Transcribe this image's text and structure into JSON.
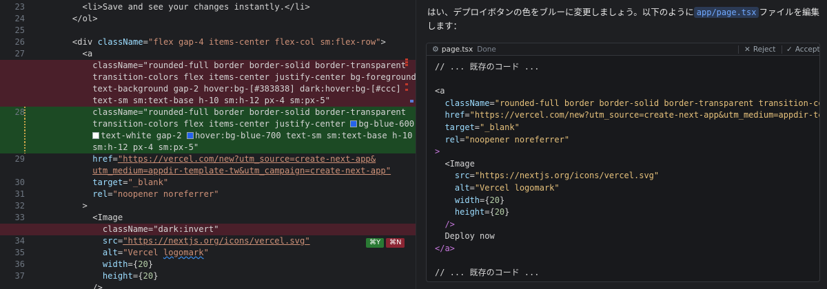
{
  "editor": {
    "lines": [
      {
        "no": "23",
        "indent": "        ",
        "parts": [
          {
            "t": "<li>Save and see your changes instantly.</li>",
            "c": "tag"
          }
        ]
      },
      {
        "no": "24",
        "indent": "      ",
        "parts": [
          {
            "t": "</ol>",
            "c": "tag"
          }
        ]
      },
      {
        "no": "25",
        "indent": "",
        "parts": []
      },
      {
        "no": "26",
        "indent": "      ",
        "parts": [
          {
            "t": "<div ",
            "c": "tag"
          },
          {
            "t": "className",
            "c": "attr"
          },
          {
            "t": "=",
            "c": "punc"
          },
          {
            "t": "\"flex gap-4 items-center flex-col sm:flex-row\"",
            "c": "str"
          },
          {
            "t": ">",
            "c": "tag"
          }
        ]
      },
      {
        "no": "27",
        "indent": "        ",
        "parts": [
          {
            "t": "<a",
            "c": "tag"
          }
        ]
      }
    ],
    "deleted_lines": [
      "className=\"rounded-full border border-solid border-transparent",
      "transition-colors flex items-center justify-center bg-foreground",
      "text-background gap-2 hover:bg-[#383838] dark:hover:bg-[#ccc]",
      "text-sm sm:text-base h-10 sm:h-12 px-4 sm:px-5\""
    ],
    "added_line_no": "28",
    "added_lines": [
      "className=\"rounded-full border border-solid border-transparent",
      "transition-colors flex items-center justify-center ",
      "text-white gap-2 ",
      "sm:h-12 px-4 sm:px-5\""
    ],
    "added_tokens": {
      "bg_blue": "bg-blue-600",
      "hover_blue": "hover:bg-blue-700 text-sm sm:text-base h-10"
    },
    "after_lines": [
      {
        "no": "29",
        "parts": [
          {
            "t": "href",
            "c": "attr"
          },
          {
            "t": "=",
            "c": "punc"
          },
          {
            "t": "\"https://vercel.com/new?utm_source=create-next-app&",
            "c": "str und"
          }
        ]
      },
      {
        "no": "",
        "parts": [
          {
            "t": "utm_medium=appdir-template-tw&utm_campaign=create-next-app\"",
            "c": "str und"
          }
        ]
      },
      {
        "no": "30",
        "parts": [
          {
            "t": "target",
            "c": "attr"
          },
          {
            "t": "=",
            "c": "punc"
          },
          {
            "t": "\"_blank\"",
            "c": "str"
          }
        ]
      },
      {
        "no": "31",
        "parts": [
          {
            "t": "rel",
            "c": "attr"
          },
          {
            "t": "=",
            "c": "punc"
          },
          {
            "t": "\"noopener noreferrer\"",
            "c": "str"
          }
        ]
      },
      {
        "no": "32",
        "parts": [
          {
            "t": ">",
            "c": "tag"
          }
        ]
      },
      {
        "no": "33",
        "parts": [
          {
            "t": "<Image",
            "c": "tag"
          }
        ]
      }
    ],
    "deleted_line_2": "className=\"dark:invert\"",
    "tail_lines": [
      {
        "no": "34",
        "parts": [
          {
            "t": "src",
            "c": "attr"
          },
          {
            "t": "=",
            "c": "punc"
          },
          {
            "t": "\"https://nextjs.org/icons/vercel.svg\"",
            "c": "str und"
          }
        ]
      },
      {
        "no": "35",
        "parts": [
          {
            "t": "alt",
            "c": "attr"
          },
          {
            "t": "=",
            "c": "punc"
          },
          {
            "t": "\"Vercel ",
            "c": "str"
          },
          {
            "t": "logomark",
            "c": "str sq"
          },
          {
            "t": "\"",
            "c": "str"
          }
        ]
      },
      {
        "no": "36",
        "parts": [
          {
            "t": "width",
            "c": "attr"
          },
          {
            "t": "={",
            "c": "punc"
          },
          {
            "t": "20",
            "c": "num"
          },
          {
            "t": "}",
            "c": "punc"
          }
        ]
      },
      {
        "no": "37",
        "parts": [
          {
            "t": "height",
            "c": "attr"
          },
          {
            "t": "={",
            "c": "punc"
          },
          {
            "t": "20",
            "c": "num"
          },
          {
            "t": "}",
            "c": "punc"
          }
        ]
      },
      {
        "no": "",
        "parts": [
          {
            "t": "/>",
            "c": "tag"
          }
        ]
      }
    ],
    "accept_shortcut": "⌘Y",
    "reject_shortcut": "⌘N"
  },
  "chat": {
    "message_before": "はい、デプロイボタンの色をブルーに変更しましょう。以下のように",
    "file_chip": "app/page.tsx",
    "message_after": "ファイルを編集します：",
    "codeblock": {
      "filename": "page.tsx",
      "status": "Done",
      "reject_label": "Reject",
      "accept_label": "Accept",
      "lines": [
        {
          "parts": [
            {
              "t": "// ... 既存のコード ...",
              "c": "comment"
            }
          ]
        },
        {
          "parts": []
        },
        {
          "parts": [
            {
              "t": "<a",
              "c": "tag"
            }
          ]
        },
        {
          "parts": [
            {
              "t": "  className",
              "c": "attr"
            },
            {
              "t": "=",
              "c": "punc"
            },
            {
              "t": "\"rounded-full border border-solid border-transparent transition-colo",
              "c": "str-y"
            }
          ]
        },
        {
          "parts": [
            {
              "t": "  href",
              "c": "attr"
            },
            {
              "t": "=",
              "c": "punc"
            },
            {
              "t": "\"https://vercel.com/new?utm_source=create-next-app&utm_medium=appdir-temp",
              "c": "str-y"
            }
          ]
        },
        {
          "parts": [
            {
              "t": "  target",
              "c": "attr"
            },
            {
              "t": "=",
              "c": "punc"
            },
            {
              "t": "\"_blank\"",
              "c": "str-y"
            }
          ]
        },
        {
          "parts": [
            {
              "t": "  rel",
              "c": "attr"
            },
            {
              "t": "=",
              "c": "punc"
            },
            {
              "t": "\"noopener noreferrer\"",
              "c": "str-y"
            }
          ]
        },
        {
          "parts": [
            {
              "t": ">",
              "c": "kw"
            }
          ]
        },
        {
          "parts": [
            {
              "t": "  <Image",
              "c": "tag"
            }
          ]
        },
        {
          "parts": [
            {
              "t": "    src",
              "c": "attr"
            },
            {
              "t": "=",
              "c": "punc"
            },
            {
              "t": "\"https://nextjs.org/icons/vercel.svg\"",
              "c": "str-y"
            }
          ]
        },
        {
          "parts": [
            {
              "t": "    alt",
              "c": "attr"
            },
            {
              "t": "=",
              "c": "punc"
            },
            {
              "t": "\"Vercel logomark\"",
              "c": "str-y"
            }
          ]
        },
        {
          "parts": [
            {
              "t": "    width",
              "c": "attr"
            },
            {
              "t": "={",
              "c": "punc"
            },
            {
              "t": "20",
              "c": "num"
            },
            {
              "t": "}",
              "c": "punc"
            }
          ]
        },
        {
          "parts": [
            {
              "t": "    height",
              "c": "attr"
            },
            {
              "t": "={",
              "c": "punc"
            },
            {
              "t": "20",
              "c": "num"
            },
            {
              "t": "}",
              "c": "punc"
            }
          ]
        },
        {
          "parts": [
            {
              "t": "  />",
              "c": "kw"
            }
          ]
        },
        {
          "parts": [
            {
              "t": "  Deploy now",
              "c": "tag"
            }
          ]
        },
        {
          "parts": [
            {
              "t": "</a>",
              "c": "kw"
            }
          ]
        },
        {
          "parts": []
        },
        {
          "parts": [
            {
              "t": "// ... 既存のコード ...",
              "c": "comment"
            }
          ]
        }
      ]
    }
  },
  "colors": {
    "diff_deleted": "#4a1f2a",
    "diff_added": "#1c4a24",
    "chip_text": "#6fa8ff"
  }
}
